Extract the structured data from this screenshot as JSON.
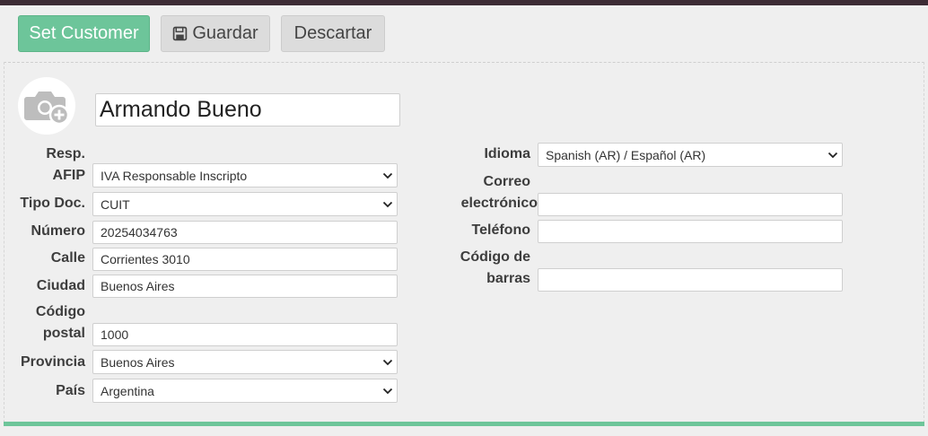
{
  "toolbar": {
    "set_customer_label": "Set Customer",
    "save_label": "Guardar",
    "discard_label": "Descartar"
  },
  "partner": {
    "name": "Armando Bueno"
  },
  "left_fields": {
    "resp_afip_label_1": "Resp.",
    "resp_afip_label_2": "AFIP",
    "resp_afip_value": "IVA Responsable Inscripto",
    "tipo_doc_label": "Tipo Doc.",
    "tipo_doc_value": "CUIT",
    "numero_label": "Número",
    "numero_value": "20254034763",
    "calle_label": "Calle",
    "calle_value": "Corrientes 3010",
    "ciudad_label": "Ciudad",
    "ciudad_value": "Buenos Aires",
    "codigo_postal_label_1": "Código",
    "codigo_postal_label_2": "postal",
    "codigo_postal_value": "1000",
    "provincia_label": "Provincia",
    "provincia_value": "Buenos Aires",
    "pais_label": "País",
    "pais_value": "Argentina"
  },
  "right_fields": {
    "idioma_label": "Idioma",
    "idioma_value": "Spanish (AR) / Español (AR)",
    "correo_label_1": "Correo",
    "correo_label_2": "electrónico",
    "correo_value": "",
    "telefono_label": "Teléfono",
    "telefono_value": "",
    "codigo_barras_label_1": "Código de",
    "codigo_barras_label_2": "barras",
    "codigo_barras_value": ""
  },
  "icons": {
    "save": "floppy-disk-icon",
    "avatar": "camera-plus-icon",
    "dropdown": "chevron-down-icon"
  },
  "colors": {
    "accent": "#6dc59a",
    "topbar": "#3d2c35",
    "background": "#efefef"
  }
}
